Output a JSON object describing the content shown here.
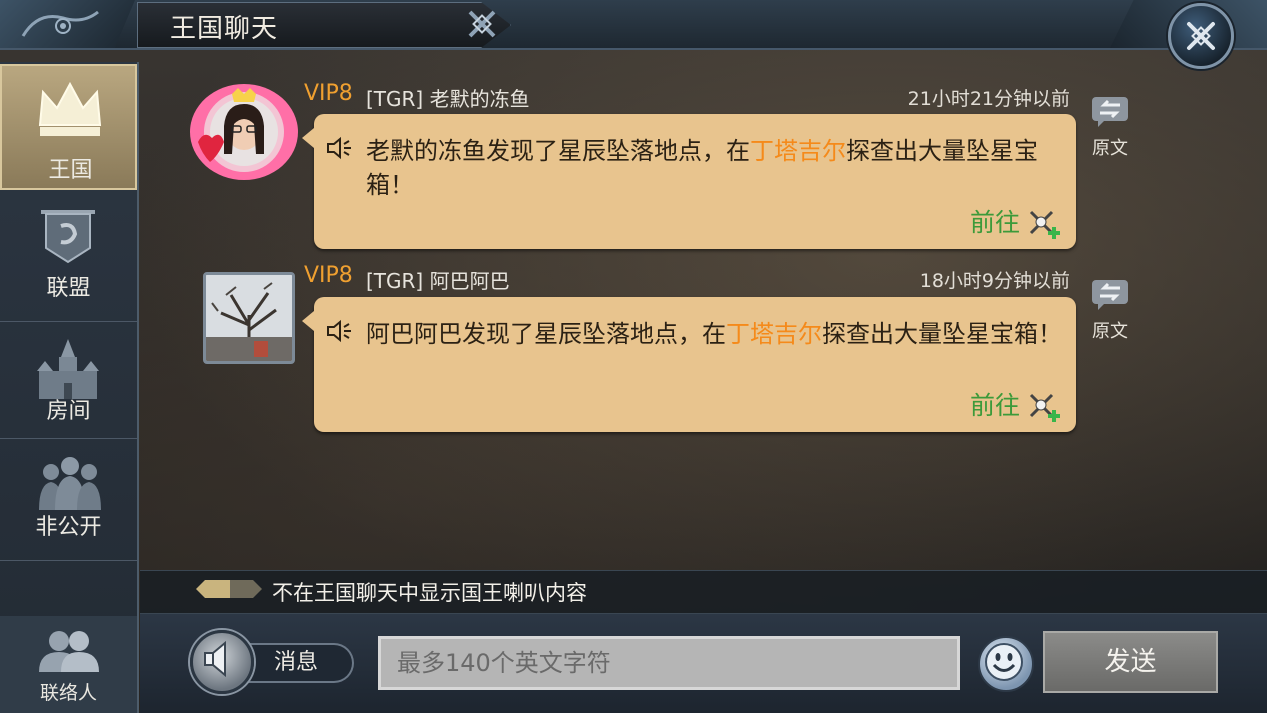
{
  "header": {
    "title": "王国聊天",
    "close_icon": "close-x-icon"
  },
  "sidebar": {
    "items": [
      {
        "label": "王国",
        "icon": "crown-icon",
        "active": true
      },
      {
        "label": "联盟",
        "icon": "alliance-banner-icon",
        "active": false
      },
      {
        "label": "房间",
        "icon": "castle-icon",
        "active": false
      },
      {
        "label": "非公开",
        "icon": "group-soldiers-icon",
        "active": false
      }
    ],
    "contacts": {
      "label": "联络人",
      "icon": "contacts-icon"
    }
  },
  "messages": [
    {
      "vip": "VIP8",
      "sender": "[TGR] 老默的冻鱼",
      "time": "21小时21分钟以前",
      "text_before": "老默的冻鱼发现了星辰坠落地点，在",
      "location": "丁塔吉尔",
      "text_after": "探查出大量坠星宝箱！",
      "goto_label": "前往",
      "translate_label": "原文"
    },
    {
      "vip": "VIP8",
      "sender": "[TGR] 阿巴阿巴",
      "time": "18小时9分钟以前",
      "text_before": "阿巴阿巴发现了星辰坠落地点，在",
      "location": "丁塔吉尔",
      "text_after": "探查出大量坠星宝箱！",
      "goto_label": "前往",
      "translate_label": "原文"
    }
  ],
  "speaker_toggle": {
    "label": "不在王国聊天中显示国王喇叭内容"
  },
  "input": {
    "message_type": "消息",
    "placeholder": "最多140个英文字符",
    "send_label": "发送"
  },
  "colors": {
    "vip": "#f0a030",
    "location_highlight": "#f58a1a",
    "goto": "#3c9a3a",
    "bubble": "#e8c48e"
  }
}
